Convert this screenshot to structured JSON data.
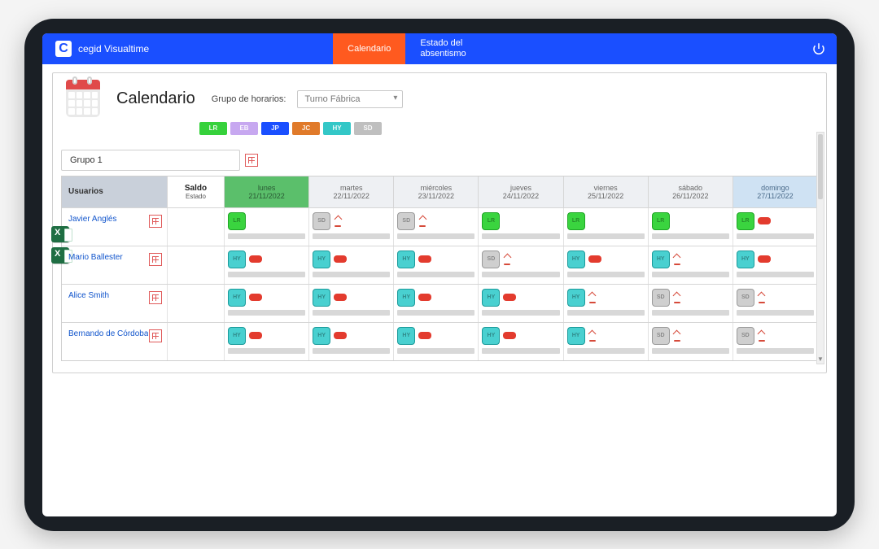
{
  "app": {
    "name": "cegid Visualtime",
    "logo_letter": "C"
  },
  "nav": {
    "tab_calendar": "Calendario",
    "tab_absence_line1": "Estado del",
    "tab_absence_line2": "absentismo"
  },
  "page": {
    "title": "Calendario",
    "schedule_group_label": "Grupo de horarios:",
    "schedule_group_value": "Turno Fábrica"
  },
  "legend": [
    {
      "code": "LR",
      "color": "bg-green"
    },
    {
      "code": "EB",
      "color": "bg-lilac"
    },
    {
      "code": "JP",
      "color": "bg-blue"
    },
    {
      "code": "JC",
      "color": "bg-orange"
    },
    {
      "code": "HY",
      "color": "bg-teal"
    },
    {
      "code": "SD",
      "color": "bg-grey"
    }
  ],
  "group_filter": "Grupo 1",
  "columns": {
    "users": "Usuarios",
    "saldo": "Saldo",
    "estado": "Estado",
    "days": [
      {
        "dow": "lunes",
        "date": "21/11/2022",
        "flag": "today"
      },
      {
        "dow": "martes",
        "date": "22/11/2022",
        "flag": ""
      },
      {
        "dow": "miércoles",
        "date": "23/11/2022",
        "flag": ""
      },
      {
        "dow": "jueves",
        "date": "24/11/2022",
        "flag": ""
      },
      {
        "dow": "viernes",
        "date": "25/11/2022",
        "flag": ""
      },
      {
        "dow": "sábado",
        "date": "26/11/2022",
        "flag": ""
      },
      {
        "dow": "domingo",
        "date": "27/11/2022",
        "flag": "sunday"
      }
    ]
  },
  "users": [
    {
      "name": "Javier Anglés",
      "cells": [
        {
          "code": "LR",
          "color": "bg-green",
          "red": false,
          "arrow": false
        },
        {
          "code": "SD",
          "color": "bg-grey",
          "red": false,
          "arrow": true
        },
        {
          "code": "SD",
          "color": "bg-grey",
          "red": false,
          "arrow": true
        },
        {
          "code": "LR",
          "color": "bg-green",
          "red": false,
          "arrow": false
        },
        {
          "code": "LR",
          "color": "bg-green",
          "red": false,
          "arrow": false
        },
        {
          "code": "LR",
          "color": "bg-green",
          "red": false,
          "arrow": false
        },
        {
          "code": "LR",
          "color": "bg-green",
          "red": true,
          "arrow": false
        }
      ]
    },
    {
      "name": "Mario Ballester",
      "cells": [
        {
          "code": "HY",
          "color": "bg-teal",
          "red": true,
          "arrow": false
        },
        {
          "code": "HY",
          "color": "bg-teal",
          "red": true,
          "arrow": false
        },
        {
          "code": "HY",
          "color": "bg-teal",
          "red": true,
          "arrow": false
        },
        {
          "code": "SD",
          "color": "bg-grey",
          "red": false,
          "arrow": true
        },
        {
          "code": "HY",
          "color": "bg-teal",
          "red": true,
          "arrow": false
        },
        {
          "code": "HY",
          "color": "bg-teal",
          "red": false,
          "arrow": true
        },
        {
          "code": "HY",
          "color": "bg-teal",
          "red": true,
          "arrow": false
        }
      ]
    },
    {
      "name": "Alice Smith",
      "cells": [
        {
          "code": "HY",
          "color": "bg-teal",
          "red": true,
          "arrow": false
        },
        {
          "code": "HY",
          "color": "bg-teal",
          "red": true,
          "arrow": false
        },
        {
          "code": "HY",
          "color": "bg-teal",
          "red": true,
          "arrow": false
        },
        {
          "code": "HY",
          "color": "bg-teal",
          "red": true,
          "arrow": false
        },
        {
          "code": "HY",
          "color": "bg-teal",
          "red": false,
          "arrow": true
        },
        {
          "code": "SD",
          "color": "bg-grey",
          "red": false,
          "arrow": true
        },
        {
          "code": "SD",
          "color": "bg-grey",
          "red": false,
          "arrow": true
        }
      ]
    },
    {
      "name": "Bernando de Córdoba",
      "cells": [
        {
          "code": "HY",
          "color": "bg-teal",
          "red": true,
          "arrow": false
        },
        {
          "code": "HY",
          "color": "bg-teal",
          "red": true,
          "arrow": false
        },
        {
          "code": "HY",
          "color": "bg-teal",
          "red": true,
          "arrow": false
        },
        {
          "code": "HY",
          "color": "bg-teal",
          "red": true,
          "arrow": false
        },
        {
          "code": "HY",
          "color": "bg-teal",
          "red": false,
          "arrow": true
        },
        {
          "code": "SD",
          "color": "bg-grey",
          "red": false,
          "arrow": true
        },
        {
          "code": "SD",
          "color": "bg-grey",
          "red": false,
          "arrow": true
        }
      ]
    }
  ]
}
